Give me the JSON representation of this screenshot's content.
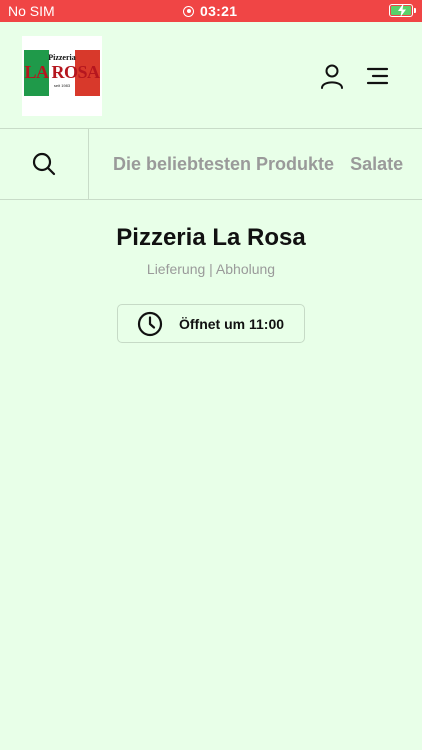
{
  "status_bar": {
    "carrier": "No SIM",
    "time": "03:21",
    "icons": [
      "recording-dot-icon",
      "battery-charging-icon"
    ]
  },
  "header": {
    "logo": {
      "top_text": "Pizzeria",
      "main_text": "LA ROSA",
      "sub_text": "seit 1983",
      "colors": {
        "green": "#1f9a4a",
        "red": "#d8392b"
      }
    },
    "icons": [
      "user-icon",
      "menu-icon"
    ]
  },
  "categories": {
    "search_icon": "search-icon",
    "items": [
      "Die beliebtesten Produkte",
      "Salate"
    ]
  },
  "restaurant": {
    "name": "Pizzeria La Rosa",
    "service_modes": "Lieferung | Abholung",
    "opening_status": "Öffnet um 11:00",
    "opening_icon": "clock-icon"
  },
  "colors": {
    "status_bar": "#f04545",
    "background": "#e8ffe8",
    "muted_text": "#9a9a9a",
    "battery": "#5ad16a"
  }
}
